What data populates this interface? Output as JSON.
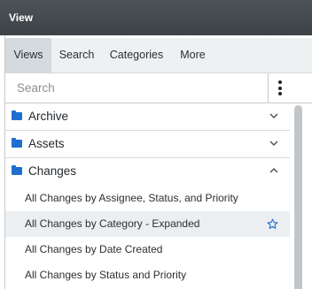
{
  "window": {
    "title": "View"
  },
  "tabs": [
    {
      "label": "Views",
      "active": true
    },
    {
      "label": "Search",
      "active": false
    },
    {
      "label": "Categories",
      "active": false
    },
    {
      "label": "More",
      "active": false
    }
  ],
  "search": {
    "placeholder": "Search",
    "value": ""
  },
  "menu_icon": "vertical-ellipsis-icon",
  "categories": [
    {
      "label": "Archive",
      "icon": "folder-icon",
      "expanded": false
    },
    {
      "label": "Assets",
      "icon": "folder-icon",
      "expanded": false
    },
    {
      "label": "Changes",
      "icon": "folder-icon",
      "expanded": true
    }
  ],
  "changes_views": [
    {
      "label": "All Changes by Assignee, Status, and Priority",
      "highlighted": false
    },
    {
      "label": "All Changes by Category - Expanded",
      "highlighted": true,
      "favorite_icon": "star-outline-icon"
    },
    {
      "label": "All Changes by Date Created",
      "highlighted": false
    },
    {
      "label": "All Changes by Status and Priority",
      "highlighted": false
    }
  ],
  "colors": {
    "titlebar": "#43494d",
    "folder_icon": "#1e6fcf",
    "active_tab": "#d4dadd",
    "star_icon": "#1e6fcf"
  }
}
